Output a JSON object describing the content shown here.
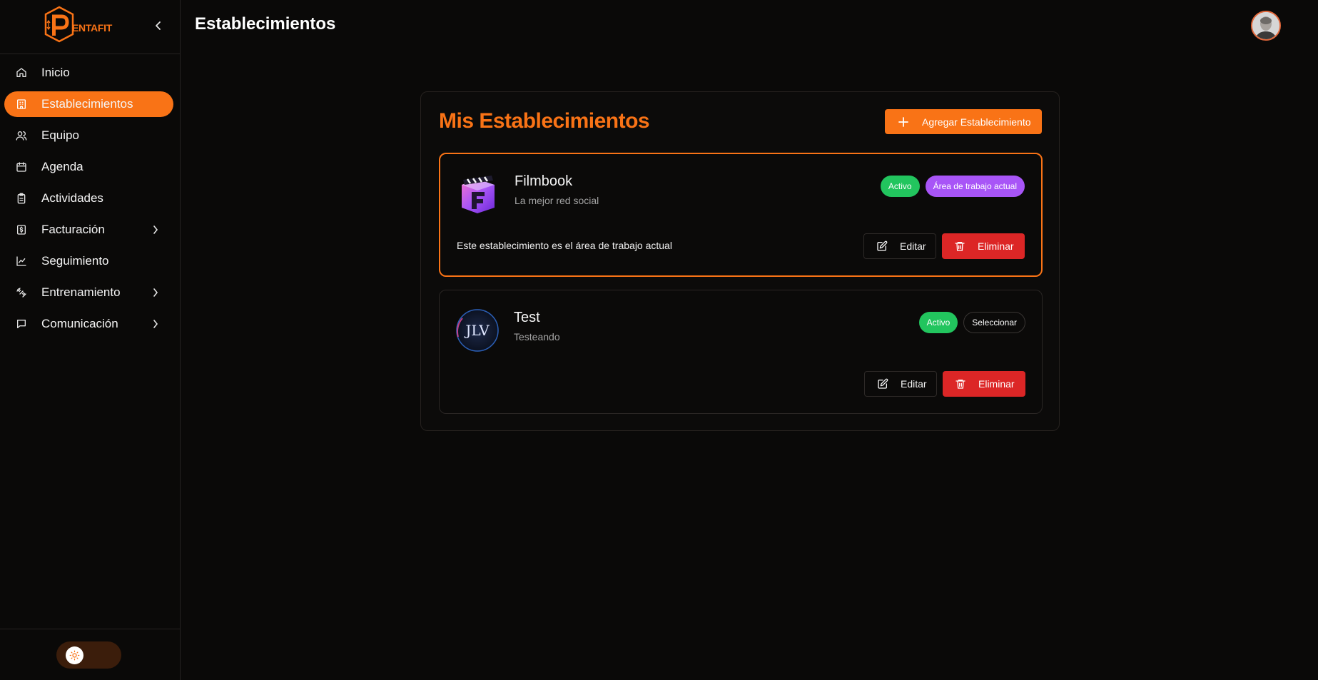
{
  "app": {
    "logo_text": "ENTAFIT"
  },
  "sidebar": {
    "items": [
      {
        "label": "Inicio",
        "icon": "home-icon",
        "has_submenu": false,
        "active": false
      },
      {
        "label": "Establecimientos",
        "icon": "building-icon",
        "has_submenu": false,
        "active": true
      },
      {
        "label": "Equipo",
        "icon": "users-icon",
        "has_submenu": false,
        "active": false
      },
      {
        "label": "Agenda",
        "icon": "calendar-icon",
        "has_submenu": false,
        "active": false
      },
      {
        "label": "Actividades",
        "icon": "clipboard-icon",
        "has_submenu": false,
        "active": false
      },
      {
        "label": "Facturación",
        "icon": "dollar-receipt-icon",
        "has_submenu": true,
        "active": false
      },
      {
        "label": "Seguimiento",
        "icon": "line-chart-icon",
        "has_submenu": false,
        "active": false
      },
      {
        "label": "Entrenamiento",
        "icon": "dumbbell-icon",
        "has_submenu": true,
        "active": false
      },
      {
        "label": "Comunicación",
        "icon": "message-icon",
        "has_submenu": true,
        "active": false
      }
    ]
  },
  "header": {
    "title": "Establecimientos"
  },
  "panel": {
    "title": "Mis Establecimientos",
    "add_label": "Agregar Establecimiento"
  },
  "establishments": [
    {
      "name": "Filmbook",
      "description": "La mejor red social",
      "status": "Activo",
      "workspace_badge": "Área de trabajo actual",
      "note": "Este establecimiento es el área de trabajo actual",
      "edit_label": "Editar",
      "delete_label": "Eliminar",
      "current": true
    },
    {
      "name": "Test",
      "description": "Testeando",
      "status": "Activo",
      "select_label": "Seleccionar",
      "edit_label": "Editar",
      "delete_label": "Eliminar",
      "current": false
    }
  ],
  "colors": {
    "accent": "#f97316",
    "active_badge": "#22c55e",
    "workspace_badge": "#a855f7",
    "danger": "#dc2626",
    "background": "#0a0908"
  }
}
